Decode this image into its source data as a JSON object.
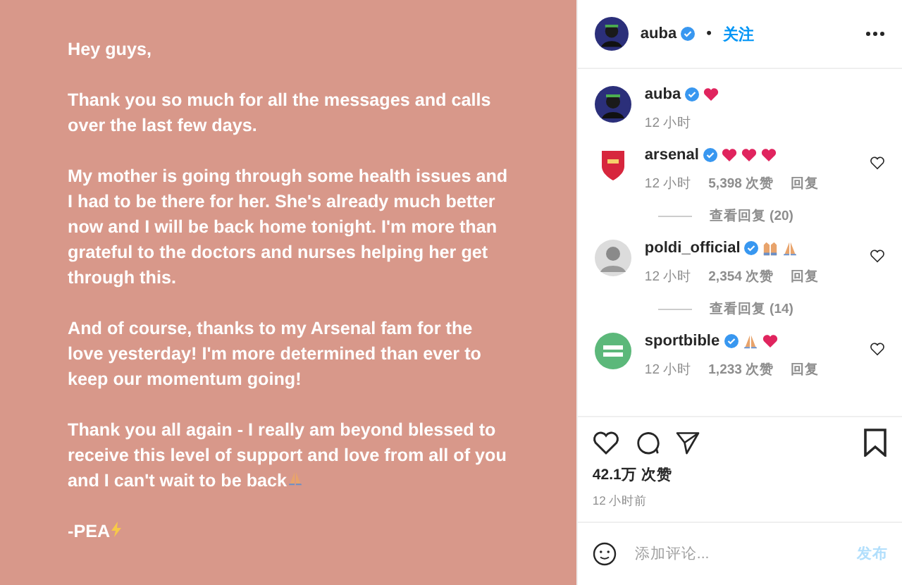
{
  "letter": {
    "paragraphs": [
      {
        "text": "Hey guys,"
      },
      {
        "text": "Thank you so much for all the messages and calls over the last few days."
      },
      {
        "text": "My mother is going through some health issues and I had to be there for her. She's already much better now and I will be back home tonight. I'm more than grateful to the doctors and nurses helping her get through this."
      },
      {
        "text": "And of course, thanks to my Arsenal fam for the love yesterday! I'm more determined than ever to keep our momentum going!"
      },
      {
        "text": "Thank you all again - I really am beyond blessed to receive this level of support and love from all of you and I can't wait to be back",
        "emoji": [
          {
            "kind": "pray"
          }
        ]
      },
      {
        "text": "-PEA",
        "emoji": [
          {
            "kind": "bolt"
          }
        ]
      }
    ]
  },
  "header": {
    "user": "auba",
    "verified": true,
    "dot": "•",
    "follow": "关注"
  },
  "caption": {
    "user": "auba",
    "verified": true,
    "emoji": [
      {
        "kind": "heart"
      }
    ],
    "time": "12 小时"
  },
  "comments": [
    {
      "user": "arsenal",
      "avatar": {
        "kind": "crest"
      },
      "verified": true,
      "emoji": [
        {
          "kind": "heart"
        },
        {
          "kind": "heart"
        },
        {
          "kind": "heart"
        }
      ],
      "time": "12 小时",
      "likes": "5,398 次赞",
      "reply": "回复",
      "view_replies": "查看回复 (20)",
      "liked": false
    },
    {
      "user": "poldi_official",
      "avatar": {
        "kind": "person"
      },
      "verified": true,
      "emoji": [
        {
          "kind": "hands"
        },
        {
          "kind": "pray"
        }
      ],
      "time": "12 小时",
      "likes": "2,354 次赞",
      "reply": "回复",
      "view_replies": "查看回复 (14)",
      "liked": false
    },
    {
      "user": "sportbible",
      "avatar": {
        "kind": "badge"
      },
      "verified": true,
      "emoji": [
        {
          "kind": "pray"
        },
        {
          "kind": "heart"
        }
      ],
      "time": "12 小时",
      "likes": "1,233 次赞",
      "reply": "回复",
      "liked": false
    }
  ],
  "actions": {
    "liked": false,
    "saved": false
  },
  "likes": "42.1万 次赞",
  "posted": "12 小时前",
  "comment_box": {
    "placeholder": "添加评论...",
    "submit": "发布"
  }
}
